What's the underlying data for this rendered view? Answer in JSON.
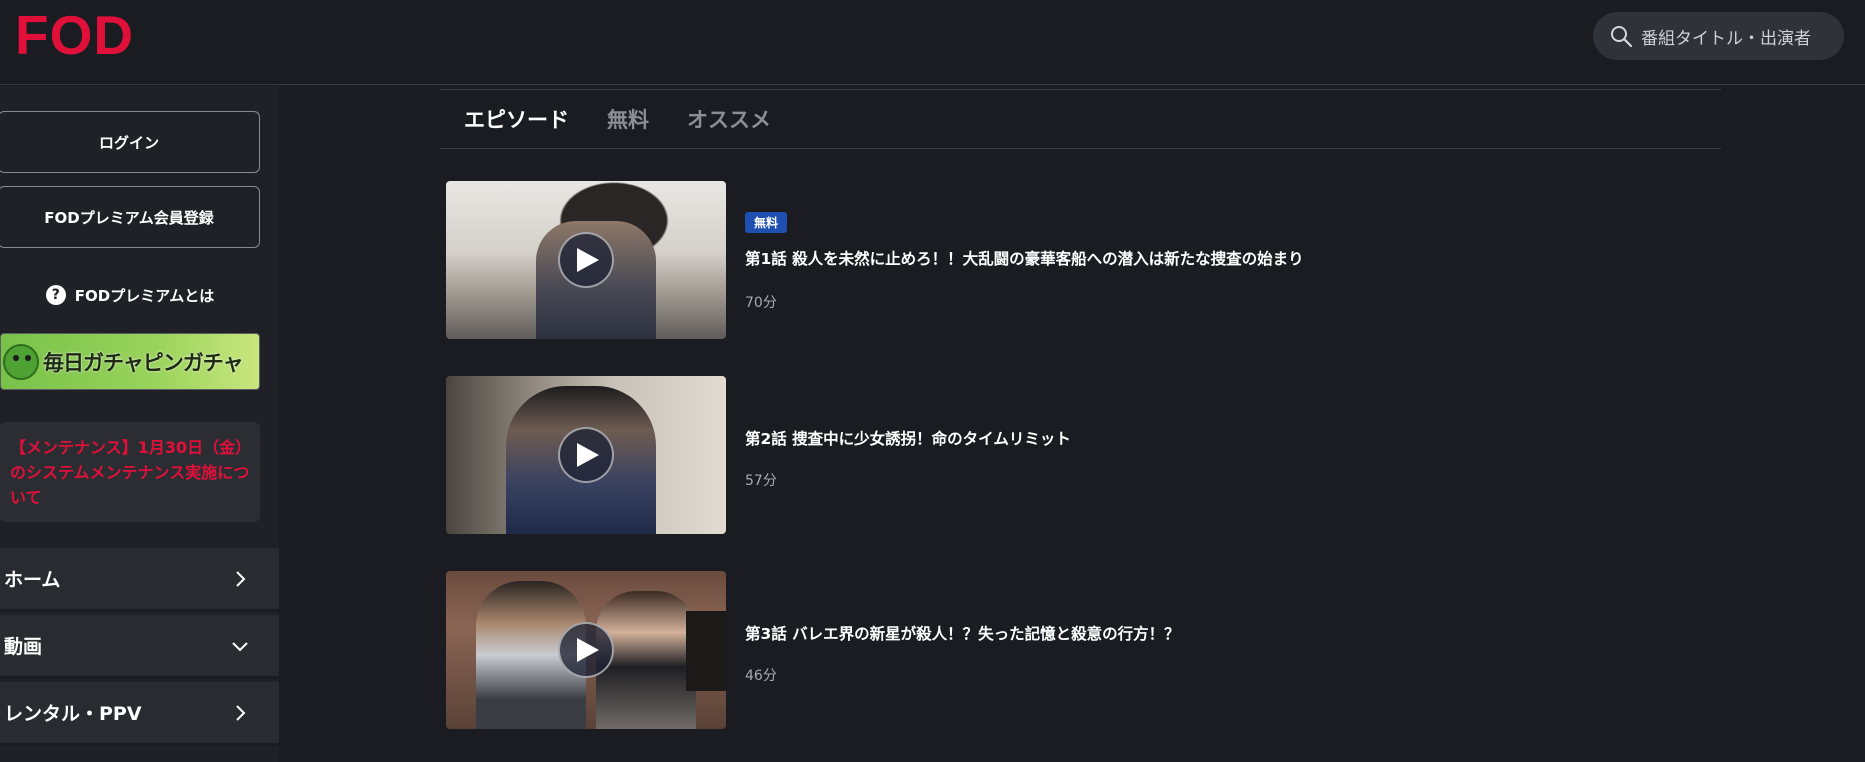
{
  "header": {
    "logo": "FOD",
    "search_placeholder": "番組タイトル・出演者"
  },
  "sidebar": {
    "login_label": "ログイン",
    "register_label": "FODプレミアム会員登録",
    "about_label": "FODプレミアムとは",
    "banner_text": "毎日ガチャピンガチャ",
    "notice_text": "【メンテナンス】1月30日（金）のシステムメンテナンス実施について",
    "menu": [
      {
        "label": "ホーム",
        "icon": "chevron-right-icon"
      },
      {
        "label": "動画",
        "icon": "chevron-down-icon"
      },
      {
        "label": "レンタル・PPV",
        "icon": "chevron-right-icon"
      }
    ]
  },
  "tabs": [
    {
      "label": "エピソード",
      "active": true
    },
    {
      "label": "無料",
      "active": false
    },
    {
      "label": "オススメ",
      "active": false
    }
  ],
  "episodes": [
    {
      "badge": "無料",
      "title": "第1話 殺人を未然に止めろ！！大乱闘の豪華客船への潜入は新たな捜査の始まり",
      "duration": "70分"
    },
    {
      "badge": "",
      "title": "第2話 捜査中に少女誘拐！命のタイムリミット",
      "duration": "57分"
    },
    {
      "badge": "",
      "title": "第3話 バレエ界の新星が殺人！？失った記憶と殺意の行方！？",
      "duration": "46分"
    }
  ],
  "colors": {
    "brand": "#e0103a",
    "background": "#1b1c22",
    "badge": "#1f4fb0"
  }
}
